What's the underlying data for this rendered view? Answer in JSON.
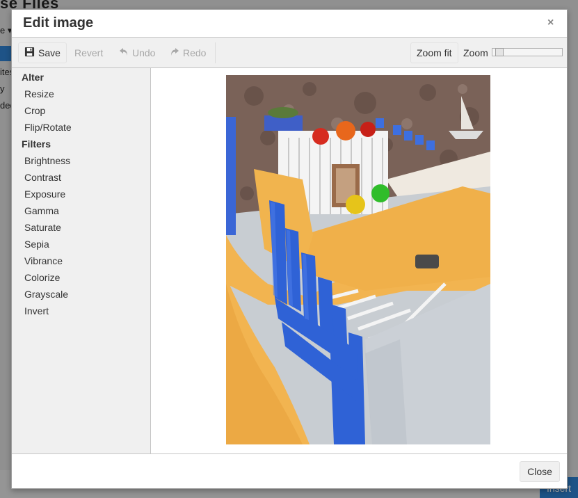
{
  "background": {
    "title": "se Files",
    "dropdown_fragment": "e ▾",
    "side_fragments": [
      "ites",
      "y",
      "dec"
    ],
    "insert_label": "Insert"
  },
  "dialog": {
    "title": "Edit image",
    "close_icon": "×"
  },
  "toolbar": {
    "save_label": "Save",
    "revert_label": "Revert",
    "undo_label": "Undo",
    "redo_label": "Redo",
    "zoom_fit_label": "Zoom fit",
    "zoom_label": "Zoom",
    "zoom_level": 0.02
  },
  "sidebar": {
    "alter_heading": "Alter",
    "alter_items": [
      "Resize",
      "Crop",
      "Flip/Rotate"
    ],
    "filters_heading": "Filters",
    "filter_items": [
      "Brightness",
      "Contrast",
      "Exposure",
      "Gamma",
      "Saturate",
      "Sepia",
      "Vibrance",
      "Colorize",
      "Grayscale",
      "Invert"
    ]
  },
  "footer": {
    "close_label": "Close"
  },
  "colors": {
    "wall_yellow": "#f2b450",
    "blue_railing": "#2f62d6",
    "stone_wall": "#7a6258",
    "floor_gray": "#c8cdd2",
    "accent_blue": "#2b78c2"
  },
  "icons": {
    "save": "floppy-disk-icon",
    "undo": "undo-arrow-icon",
    "redo": "redo-arrow-icon",
    "close": "close-icon"
  }
}
